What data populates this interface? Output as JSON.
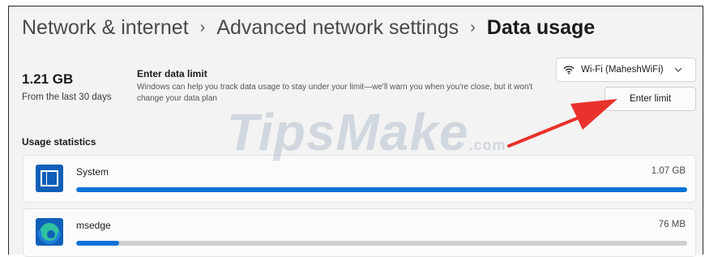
{
  "breadcrumb": {
    "items": [
      "Network & internet",
      "Advanced network settings"
    ],
    "current": "Data usage",
    "separator": "›"
  },
  "summary": {
    "total": "1.21 GB",
    "period": "From the last 30 days"
  },
  "limit": {
    "title": "Enter data limit",
    "description": "Windows can help you track data usage to stay under your limit—we'll warn you when you're close, but it won't change your data plan",
    "button_label": "Enter limit"
  },
  "network_select": {
    "value": "Wi-Fi (MaheshWiFi)",
    "icon": "wifi-icon"
  },
  "usage": {
    "label": "Usage statistics",
    "apps": [
      {
        "name": "System",
        "size": "1.07 GB",
        "fraction": 1.0,
        "icon": "system-window-icon"
      },
      {
        "name": "msedge",
        "size": "76 MB",
        "fraction": 0.07,
        "icon": "edge-icon"
      }
    ]
  },
  "watermark": {
    "text": "TipsMake",
    "suffix": ".com"
  },
  "colors": {
    "accent": "#0a73d6",
    "arrow": "#e8322b",
    "track": "#cfcfcf"
  }
}
